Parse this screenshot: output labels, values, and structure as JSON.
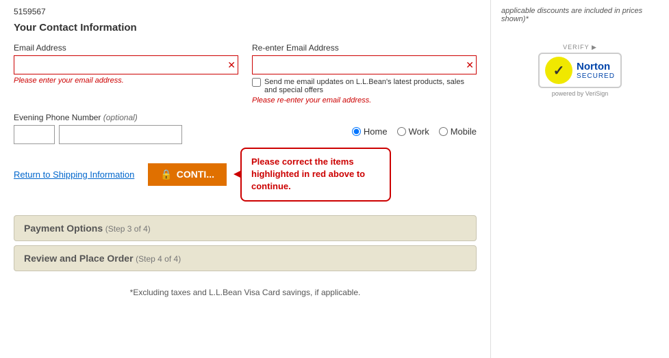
{
  "page": {
    "order_number": "5159567",
    "contact_section_title": "Your Contact Information",
    "email_label": "Email Address",
    "email_placeholder": "",
    "email_error": "Please enter your email address.",
    "reenter_email_label": "Re-enter Email Address",
    "reenter_email_placeholder": "",
    "reenter_email_error": "Please re-enter your email address.",
    "email_subscribe_label": "Send me email updates on L.L.Bean's latest products, sales and special offers",
    "phone_label": "Evening Phone Number",
    "phone_optional": "(optional)",
    "phone_type_home": "Home",
    "phone_type_work": "Work",
    "phone_type_mobile": "Mobile",
    "return_link": "Return to Shipping Information",
    "continue_btn": "CONTI...",
    "error_callout": "Please correct the items highlighted in red above to continue.",
    "payment_step_title": "Payment Options",
    "payment_step_sub": "(Step 3 of 4)",
    "review_step_title": "Review and Place Order",
    "review_step_sub": "(Step 4 of 4)",
    "footer_note": "*Excluding taxes and L.L.Bean Visa Card savings, if applicable.",
    "sidebar_note": "applicable discounts are included in prices shown)*",
    "norton_verify_label": "VERIFY",
    "norton_secured_label": "SECURED",
    "norton_powered": "powered by VeriSign"
  }
}
